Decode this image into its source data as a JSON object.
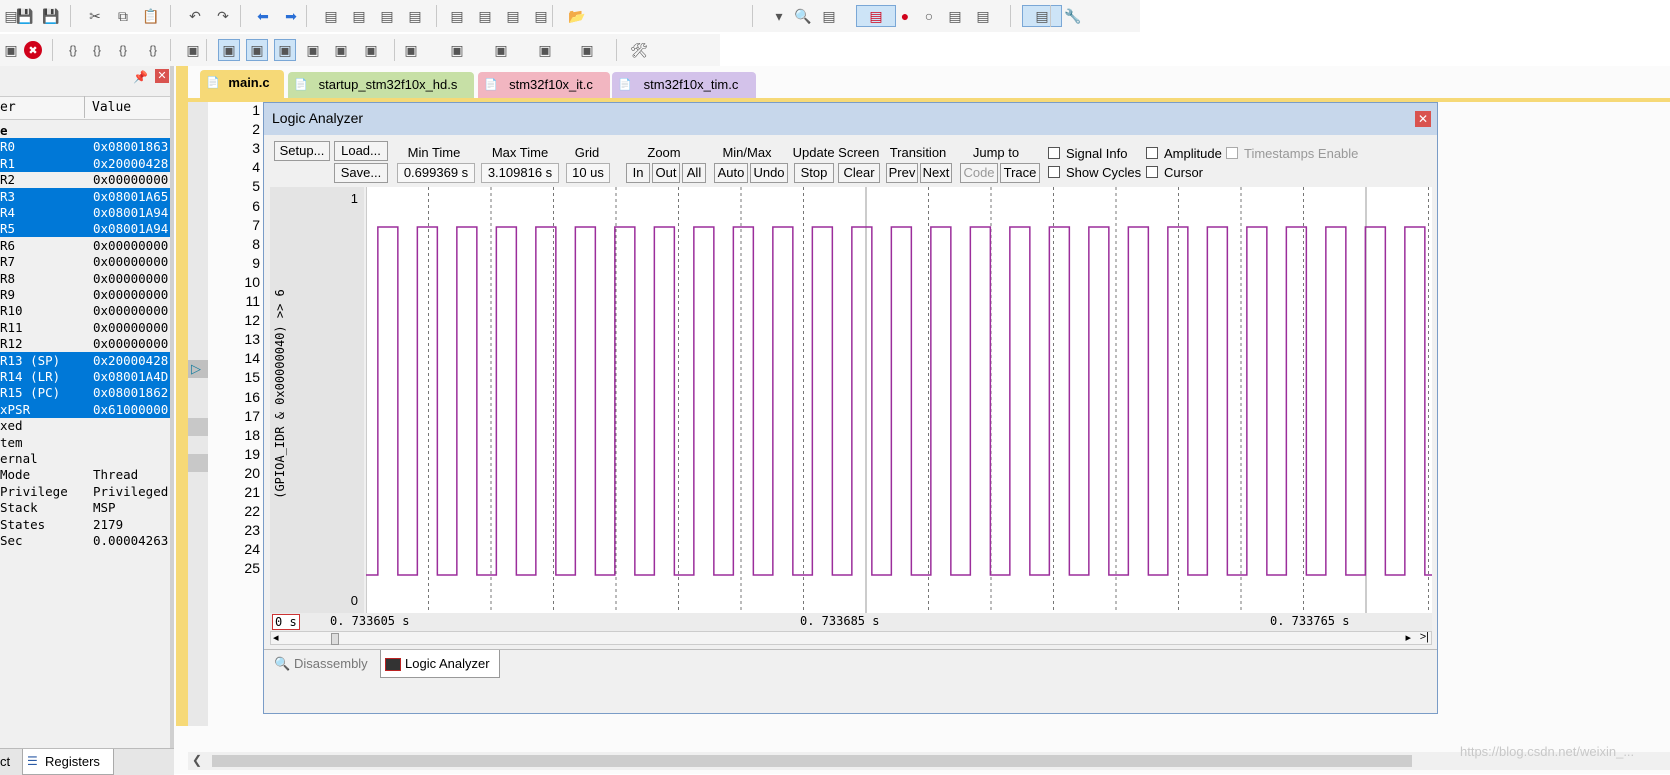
{
  "toolbar1_icons": [
    "new-file-icon",
    "save-icon",
    "save-all-icon",
    "cut-icon",
    "copy-icon",
    "paste-icon",
    "undo-icon",
    "redo-icon",
    "back-icon",
    "forward-icon",
    "bookmark-icon",
    "bookmark-prev-icon",
    "bookmark-next-icon",
    "bookmark-clear-icon",
    "indent-icon",
    "unindent-icon",
    "comment-icon",
    "uncomment-icon",
    "open-folder-icon",
    "dropdown-icon",
    "find-icon",
    "find-in-files-icon",
    "debug-session-icon",
    "breakpoint-icon",
    "breakpoint-disable-icon",
    "breakpoint-disable-all-icon",
    "breakpoint-kill-icon",
    "window-layout-icon",
    "settings-icon"
  ],
  "left_panel": {
    "col_name": "er",
    "col_value": "Value",
    "registers": [
      {
        "name": "e",
        "value": "",
        "selected": false,
        "bold": true
      },
      {
        "name": "R0",
        "value": "0x08001863",
        "selected": true
      },
      {
        "name": "R1",
        "value": "0x20000428",
        "selected": true
      },
      {
        "name": "R2",
        "value": "0x00000000",
        "selected": false
      },
      {
        "name": "R3",
        "value": "0x08001A65",
        "selected": true
      },
      {
        "name": "R4",
        "value": "0x08001A94",
        "selected": true
      },
      {
        "name": "R5",
        "value": "0x08001A94",
        "selected": true
      },
      {
        "name": "R6",
        "value": "0x00000000",
        "selected": false
      },
      {
        "name": "R7",
        "value": "0x00000000",
        "selected": false
      },
      {
        "name": "R8",
        "value": "0x00000000",
        "selected": false
      },
      {
        "name": "R9",
        "value": "0x00000000",
        "selected": false
      },
      {
        "name": "R10",
        "value": "0x00000000",
        "selected": false
      },
      {
        "name": "R11",
        "value": "0x00000000",
        "selected": false
      },
      {
        "name": "R12",
        "value": "0x00000000",
        "selected": false
      },
      {
        "name": "R13 (SP)",
        "value": "0x20000428",
        "selected": true
      },
      {
        "name": "R14 (LR)",
        "value": "0x08001A4D",
        "selected": true
      },
      {
        "name": "R15 (PC)",
        "value": "0x08001862",
        "selected": true
      },
      {
        "name": "xPSR",
        "value": "0x61000000",
        "selected": true
      },
      {
        "name": "xed",
        "value": "",
        "selected": false
      },
      {
        "name": "tem",
        "value": "",
        "selected": false
      },
      {
        "name": "ernal",
        "value": "",
        "selected": false
      },
      {
        "name": "Mode",
        "value": "Thread",
        "selected": false
      },
      {
        "name": "Privilege",
        "value": "Privileged",
        "selected": false
      },
      {
        "name": "Stack",
        "value": "MSP",
        "selected": false
      },
      {
        "name": "States",
        "value": "2179",
        "selected": false
      },
      {
        "name": "Sec",
        "value": "0.00004263",
        "selected": false
      }
    ],
    "bottom_tab_left": "ct",
    "bottom_tab_registers": "Registers"
  },
  "editor_tabs": [
    {
      "label": "main.c",
      "color": "#f6d977",
      "active": true
    },
    {
      "label": "startup_stm32f10x_hd.s",
      "color": "#c7e0a6",
      "active": false
    },
    {
      "label": "stm32f10x_it.c",
      "color": "#f2b6c1",
      "active": false
    },
    {
      "label": "stm32f10x_tim.c",
      "color": "#d3c2ea",
      "active": false
    }
  ],
  "line_numbers": [
    "1",
    "2",
    "3",
    "4",
    "5",
    "6",
    "7",
    "8",
    "9",
    "10",
    "11",
    "12",
    "13",
    "14",
    "15",
    "16",
    "17",
    "18",
    "19",
    "20",
    "21",
    "22",
    "23",
    "24",
    "25"
  ],
  "logic_analyzer": {
    "title": "Logic Analyzer",
    "setup": "Setup...",
    "load": "Load...",
    "save": "Save...",
    "min_time_label": "Min Time",
    "min_time": "0.699369 s",
    "max_time_label": "Max Time",
    "max_time": "3.109816 s",
    "grid_label": "Grid",
    "grid": "10 us",
    "zoom_label": "Zoom",
    "zoom_in": "In",
    "zoom_out": "Out",
    "zoom_all": "All",
    "minmax_label": "Min/Max",
    "auto": "Auto",
    "undo": "Undo",
    "update_label": "Update Screen",
    "stop": "Stop",
    "clear": "Clear",
    "transition_label": "Transition",
    "prev": "Prev",
    "next": "Next",
    "jump_label": "Jump to",
    "code": "Code",
    "trace": "Trace",
    "signal_info": "Signal Info",
    "show_cycles": "Show Cycles",
    "amplitude": "Amplitude",
    "cursor": "Cursor",
    "timestamps": "Timestamps Enable",
    "signal_name": "(GPIOA_IDR & 0x00000040) >> 6",
    "y_high": "1",
    "y_low": "0",
    "cursor_time": "0 s",
    "time_left": "0. 733605  s",
    "time_mid": "0. 733685  s",
    "time_right": "0. 733765  s",
    "tab_disassembly": "Disassembly",
    "tab_logic": "Logic Analyzer",
    "waveform_color": "#9b2d9b"
  },
  "watermark": "https://blog.csdn.net/weixin_..."
}
